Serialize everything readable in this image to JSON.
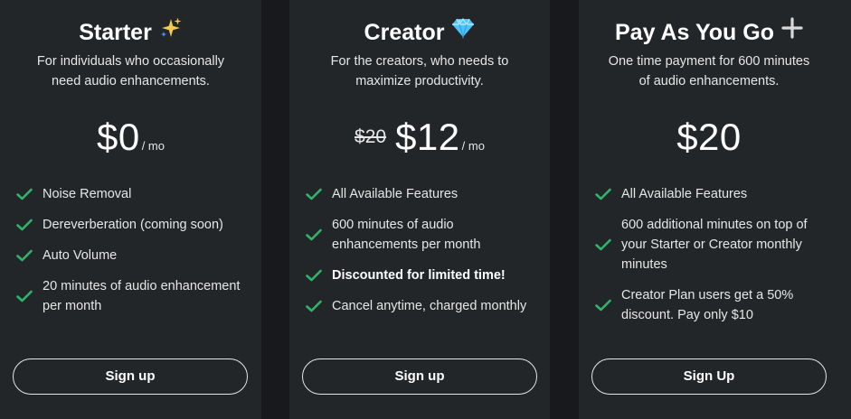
{
  "colors": {
    "background": "#17191c",
    "card": "#232629",
    "check": "#2fb56a",
    "text": "#ffffff",
    "muted": "#e6e6e6"
  },
  "plans": [
    {
      "title": "Starter",
      "icon": "sparkles-icon",
      "desc_lines": [
        "For individuals who occasionally",
        "need audio enhancements."
      ],
      "old_price": "",
      "price": "$0",
      "per": "/ mo",
      "features": [
        {
          "lines": [
            "Noise Removal"
          ]
        },
        {
          "lines": [
            "Dereverberation (coming soon)"
          ]
        },
        {
          "lines": [
            "Auto Volume"
          ]
        },
        {
          "lines": [
            "20 minutes of audio enhancement",
            "per month"
          ]
        }
      ],
      "button": "Sign up"
    },
    {
      "title": "Creator",
      "icon": "gem-icon",
      "desc_lines": [
        "For the creators, who needs to",
        "maximize productivity."
      ],
      "old_price": "$20",
      "price": "$12",
      "per": "/ mo",
      "features": [
        {
          "lines": [
            "All Available Features"
          ]
        },
        {
          "lines": [
            "600 minutes of audio",
            "enhancements per month"
          ]
        },
        {
          "lines": [
            "Discounted for limited time!"
          ],
          "bold": true
        },
        {
          "lines": [
            "Cancel anytime, charged monthly"
          ]
        }
      ],
      "button": "Sign up"
    },
    {
      "title": "Pay As You Go",
      "icon": "plus-icon",
      "desc_lines": [
        "One time payment for 600 minutes",
        "of audio enhancements."
      ],
      "old_price": "",
      "price": "$20",
      "per": "",
      "features": [
        {
          "lines": [
            "All Available Features"
          ]
        },
        {
          "lines": [
            "600 additional minutes on top of",
            "your Starter or Creator monthly",
            "minutes"
          ]
        },
        {
          "lines": [
            "Creator Plan users get a 50%",
            "discount. Pay only $10"
          ]
        }
      ],
      "button": "Sign Up"
    }
  ]
}
